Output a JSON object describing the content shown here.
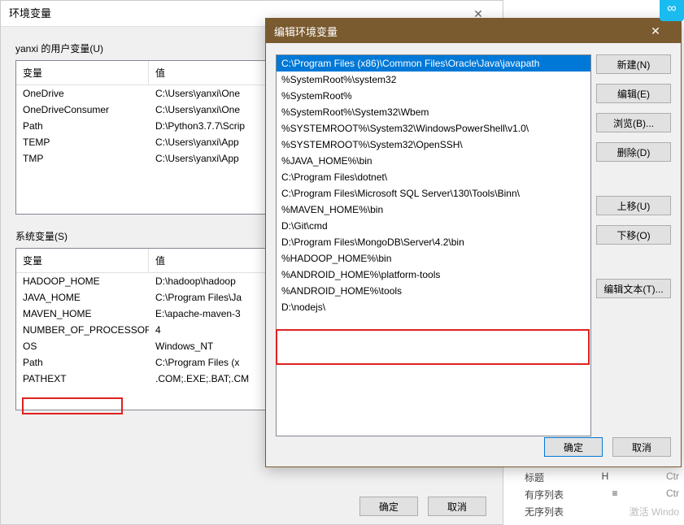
{
  "back": {
    "title": "环境变量",
    "user_section": "yanxi 的用户变量(U)",
    "sys_section": "系统变量(S)",
    "hdr_var": "变量",
    "hdr_val": "值",
    "user_vars": [
      {
        "name": "OneDrive",
        "value": "C:\\Users\\yanxi\\One"
      },
      {
        "name": "OneDriveConsumer",
        "value": "C:\\Users\\yanxi\\One"
      },
      {
        "name": "Path",
        "value": "D:\\Python3.7.7\\Scrip"
      },
      {
        "name": "TEMP",
        "value": "C:\\Users\\yanxi\\App"
      },
      {
        "name": "TMP",
        "value": "C:\\Users\\yanxi\\App"
      }
    ],
    "sys_vars": [
      {
        "name": "HADOOP_HOME",
        "value": "D:\\hadoop\\hadoop"
      },
      {
        "name": "JAVA_HOME",
        "value": "C:\\Program Files\\Ja"
      },
      {
        "name": "MAVEN_HOME",
        "value": "E:\\apache-maven-3"
      },
      {
        "name": "NUMBER_OF_PROCESSORS",
        "value": "4"
      },
      {
        "name": "OS",
        "value": "Windows_NT"
      },
      {
        "name": "Path",
        "value": "C:\\Program Files (x"
      },
      {
        "name": "PATHEXT",
        "value": ".COM;.EXE;.BAT;.CM"
      }
    ],
    "ok": "确定",
    "cancel": "取消"
  },
  "front": {
    "title": "编辑环境变量",
    "items": [
      "C:\\Program Files (x86)\\Common Files\\Oracle\\Java\\javapath",
      "%SystemRoot%\\system32",
      "%SystemRoot%",
      "%SystemRoot%\\System32\\Wbem",
      "%SYSTEMROOT%\\System32\\WindowsPowerShell\\v1.0\\",
      "%SYSTEMROOT%\\System32\\OpenSSH\\",
      "%JAVA_HOME%\\bin",
      "C:\\Program Files\\dotnet\\",
      "C:\\Program Files\\Microsoft SQL Server\\130\\Tools\\Binn\\",
      "%MAVEN_HOME%\\bin",
      "D:\\Git\\cmd",
      "D:\\Program Files\\MongoDB\\Server\\4.2\\bin",
      "%HADOOP_HOME%\\bin",
      "%ANDROID_HOME%\\platform-tools",
      "%ANDROID_HOME%\\tools",
      "D:\\nodejs\\"
    ],
    "selected_index": 0,
    "btn_new": "新建(N)",
    "btn_edit": "编辑(E)",
    "btn_browse": "浏览(B)...",
    "btn_delete": "删除(D)",
    "btn_up": "上移(U)",
    "btn_down": "下移(O)",
    "btn_edittext": "编辑文本(T)...",
    "ok": "确定",
    "cancel": "取消"
  },
  "side": {
    "title_label": "标题",
    "title_key": "H",
    "title_sc": "Ctr",
    "ol_label": "有序列表",
    "ol_key": "≡",
    "ol_sc": "Ctr",
    "ul_label": "无序列表"
  },
  "watermark": "激活 Windo"
}
